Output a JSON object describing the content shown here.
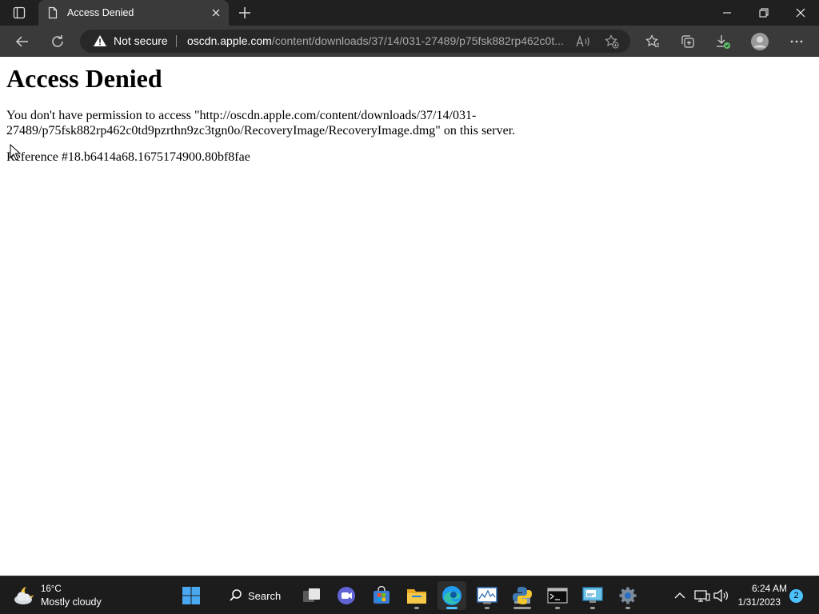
{
  "browser": {
    "tab": {
      "title": "Access Denied",
      "favicon": "document-icon"
    },
    "address_bar": {
      "security_label": "Not secure",
      "url_host": "oscdn.apple.com",
      "url_path": "/content/downloads/37/14/031-27489/p75fsk882rp462c0t..."
    },
    "colors": {
      "titlebar": "#202020",
      "toolbar": "#3a3a3a",
      "addressbar": "#282828",
      "accent": "#4cc2ff"
    }
  },
  "page": {
    "heading": "Access Denied",
    "message": "You don't have permission to access \"http://oscdn.apple.com/content/downloads/37/14/031-27489/p75fsk882rp462c0td9pzrthn9zc3tgn0o/RecoveryImage/RecoveryImage.dmg\" on this server.",
    "message_line1": "You don't have permission to access \"http://oscdn.apple.com/content/downloads/37/14/031-",
    "message_line2": "27489/p75fsk882rp462c0td9pzrthn9zc3tgn0o/RecoveryImage/RecoveryImage.dmg\" on this server.",
    "reference": "Reference #18.b6414a68.1675174900.80bf8fae"
  },
  "taskbar": {
    "weather": {
      "temperature": "16°C",
      "condition": "Mostly cloudy",
      "icon": "cloud-moon-icon"
    },
    "search_label": "Search",
    "apps": [
      "start-icon",
      "task-view-icon",
      "teams-chat-icon",
      "store-icon",
      "file-explorer-icon",
      "edge-icon",
      "resource-monitor-icon",
      "python-icon",
      "terminal-icon",
      "remote-desktop-icon",
      "settings-icon"
    ],
    "clock": {
      "time": "6:24 AM",
      "date": "1/31/2023"
    },
    "notification_count": "2"
  }
}
